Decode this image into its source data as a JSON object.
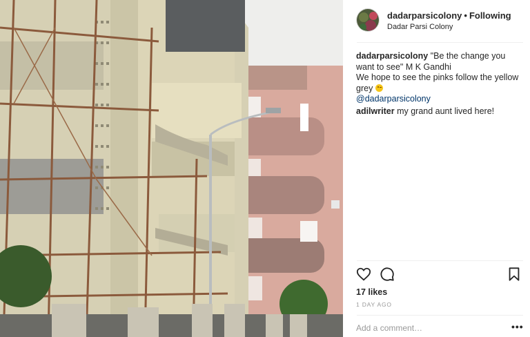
{
  "post": {
    "image_description_icon": "photo-building-icon"
  },
  "header": {
    "username": "dadarparsicolony",
    "separator": "•",
    "follow_status": "Following",
    "location": "Dadar Parsi Colony"
  },
  "comments": [
    {
      "user": "dadarparsicolony",
      "lines": [
        "\"Be the change you want to see\" M K Gandhi",
        "We hope to see the pinks follow the yellow grey"
      ],
      "mention": "@dadarparsicolony"
    },
    {
      "user": "adilwriter",
      "text": "my grand aunt lived here!"
    }
  ],
  "actions": {
    "like_icon": "heart-icon",
    "comment_icon": "comment-bubble-icon",
    "save_icon": "bookmark-icon"
  },
  "likes_text": "17 likes",
  "date_text": "1 DAY AGO",
  "add_comment": {
    "placeholder": "Add a comment…",
    "more_label": "•••"
  },
  "colors": {
    "text": "#262626",
    "muted": "#999999",
    "link": "#003569",
    "divider": "#efefef"
  }
}
